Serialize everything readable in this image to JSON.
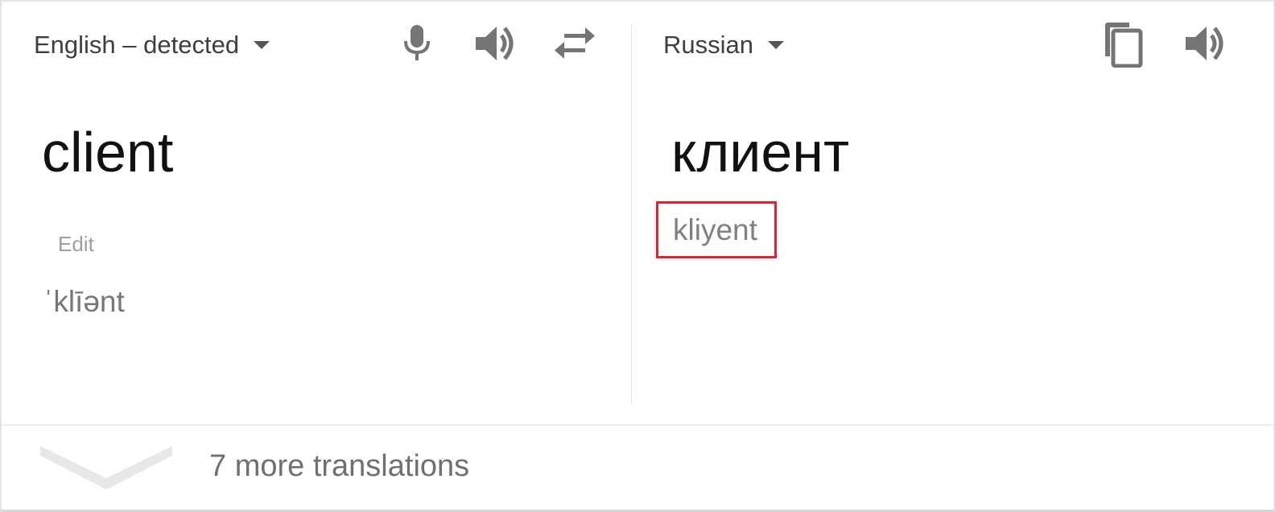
{
  "source": {
    "language_label": "English – detected",
    "text": "client",
    "edit_label": "Edit",
    "pronunciation": "ˈklīənt"
  },
  "target": {
    "language_label": "Russian",
    "text": "клиент",
    "transliteration": "kliyent"
  },
  "footer": {
    "more_translations_label": "7 more translations"
  },
  "icons": {
    "source_toolbar": [
      "microphone-icon",
      "speaker-icon",
      "swap-languages-icon"
    ],
    "target_toolbar": [
      "copy-icon",
      "speaker-icon"
    ],
    "expand": "chevron-down-icon"
  },
  "colors": {
    "highlight_border": "#e3212d",
    "icon_gray": "#757575"
  }
}
